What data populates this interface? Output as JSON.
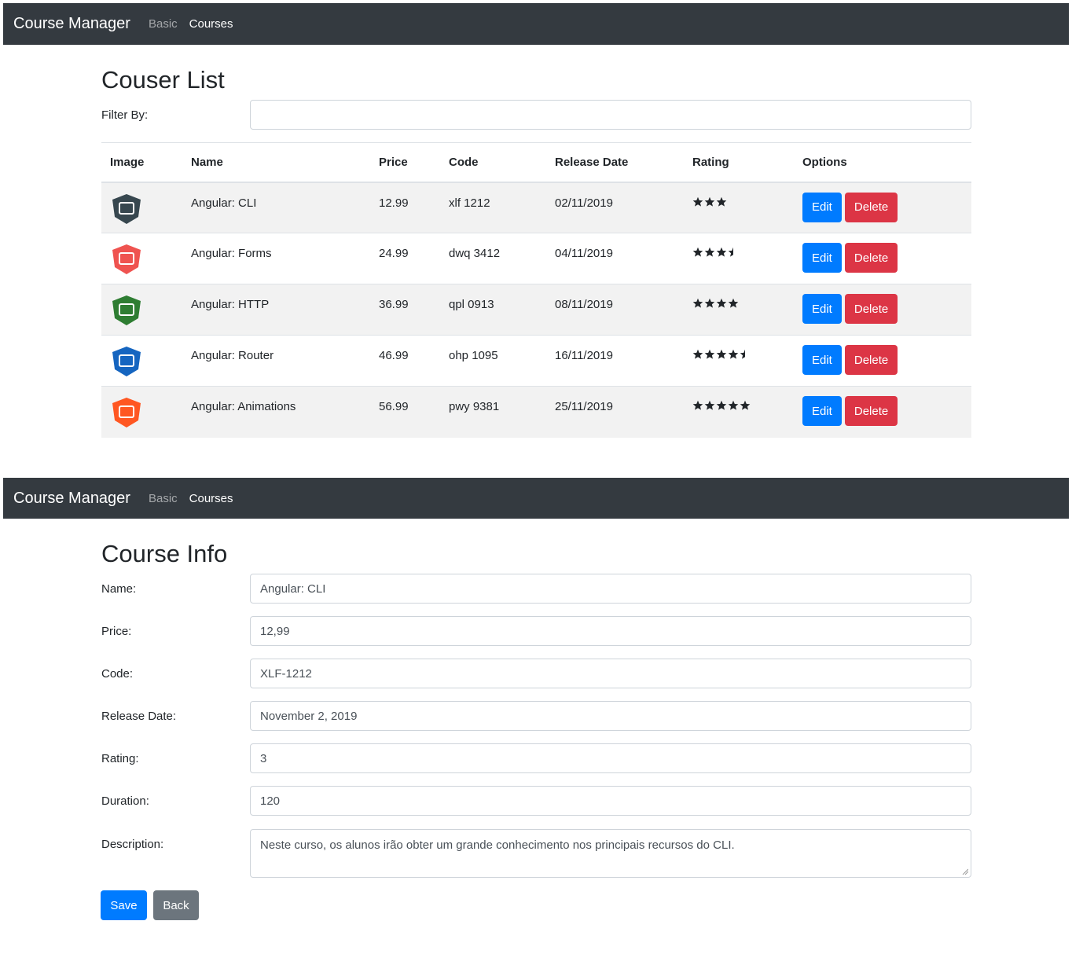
{
  "navbar": {
    "brand": "Course Manager",
    "links": [
      "Basic",
      "Courses"
    ]
  },
  "list": {
    "title": "Couser List",
    "filter_label": "Filter By:",
    "filter_value": "",
    "columns": [
      "Image",
      "Name",
      "Price",
      "Code",
      "Release Date",
      "Rating",
      "Options"
    ],
    "rows": [
      {
        "icon": "angular-cli-icon",
        "color": "#37474f",
        "name": "Angular: CLI",
        "price": "12.99",
        "code": "xlf 1212",
        "date": "02/11/2019",
        "rating": 3
      },
      {
        "icon": "angular-forms-icon",
        "color": "#ef5350",
        "name": "Angular: Forms",
        "price": "24.99",
        "code": "dwq 3412",
        "date": "04/11/2019",
        "rating": 3.5
      },
      {
        "icon": "angular-http-icon",
        "color": "#2e7d32",
        "name": "Angular: HTTP",
        "price": "36.99",
        "code": "qpl 0913",
        "date": "08/11/2019",
        "rating": 4
      },
      {
        "icon": "angular-router-icon",
        "color": "#1565c0",
        "name": "Angular: Router",
        "price": "46.99",
        "code": "ohp 1095",
        "date": "16/11/2019",
        "rating": 4.5
      },
      {
        "icon": "angular-animations-icon",
        "color": "#ff5722",
        "name": "Angular: Animations",
        "price": "56.99",
        "code": "pwy 9381",
        "date": "25/11/2019",
        "rating": 5
      }
    ],
    "edit_label": "Edit",
    "delete_label": "Delete"
  },
  "info": {
    "title": "Course Info",
    "fields": [
      {
        "label": "Name:",
        "value": "Angular: CLI"
      },
      {
        "label": "Price:",
        "value": "12,99"
      },
      {
        "label": "Code:",
        "value": "XLF-1212"
      },
      {
        "label": "Release Date:",
        "value": "November 2, 2019"
      },
      {
        "label": "Rating:",
        "value": "3"
      },
      {
        "label": "Duration:",
        "value": "120"
      },
      {
        "label": "Description:",
        "value": "Neste curso, os alunos irão obter um grande conhecimento nos principais recursos do CLI."
      }
    ],
    "save_label": "Save",
    "back_label": "Back"
  },
  "colors": {
    "navbar": "#343a40",
    "primary": "#007bff",
    "danger": "#dc3545",
    "secondary": "#6c757d"
  }
}
